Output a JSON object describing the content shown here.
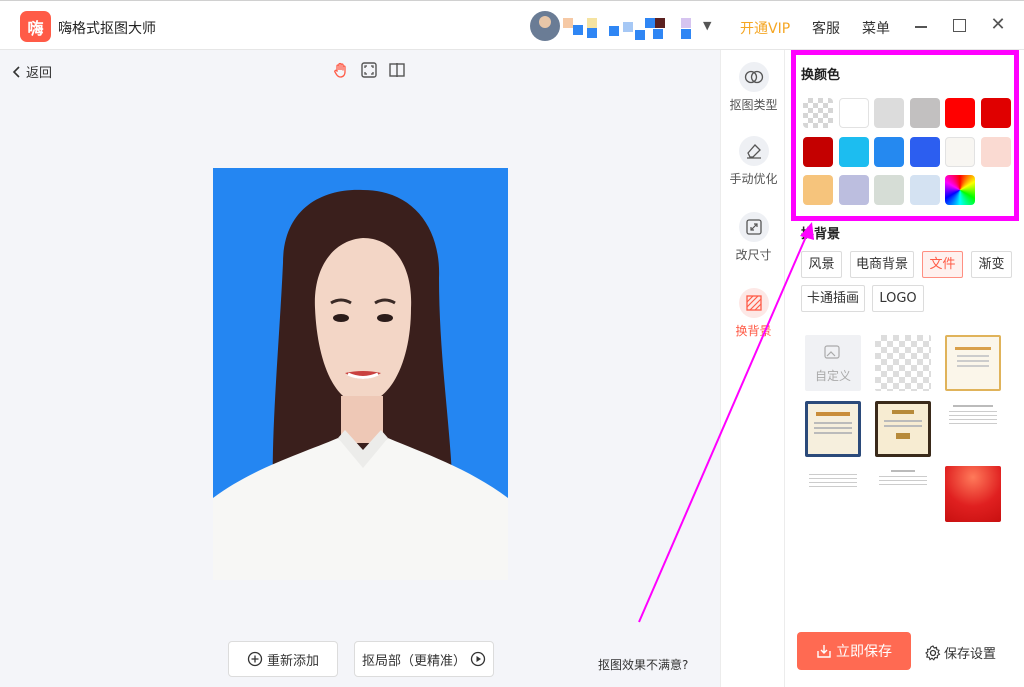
{
  "app": {
    "title": "嗨格式抠图大师",
    "logo_glyph": "嗨"
  },
  "header": {
    "vip_label": "开通VIP",
    "service_label": "客服",
    "menu_label": "菜单"
  },
  "toolbar": {
    "back_label": "返回"
  },
  "canvas": {
    "readd_label": "重新添加",
    "local_cut_label": "抠局部（更精准）",
    "not_satisfied_label": "抠图效果不满意?"
  },
  "side_tools": [
    {
      "label": "抠图类型",
      "icon": "cutout-type-icon"
    },
    {
      "label": "手动优化",
      "icon": "eraser-icon"
    },
    {
      "label": "改尺寸",
      "icon": "resize-icon"
    },
    {
      "label": "换背景",
      "icon": "background-icon",
      "active": true
    }
  ],
  "panel": {
    "color_title": "换颜色",
    "colors": [
      "transparent",
      "#ffffff",
      "#dcdcdc",
      "#c2c0c0",
      "#ff0000",
      "#e00000",
      "#c40000",
      "#1cbdf0",
      "#2589f0",
      "#2c5ef0",
      "#f8f6f2",
      "#fadad2",
      "#f6c47c",
      "#bcbedf",
      "#d6ddd6",
      "#d4e2f2",
      "gradient"
    ],
    "bg_title": "换背景",
    "bg_tabs": [
      "风景",
      "电商背景",
      "文件",
      "渐变",
      "卡通插画",
      "LOGO"
    ],
    "bg_active_tab": "文件",
    "custom_label": "自定义",
    "save_label": "立即保存",
    "save_settings_label": "保存设置"
  },
  "accent_color": "#ff5b47",
  "highlight_color": "#ff00ff"
}
